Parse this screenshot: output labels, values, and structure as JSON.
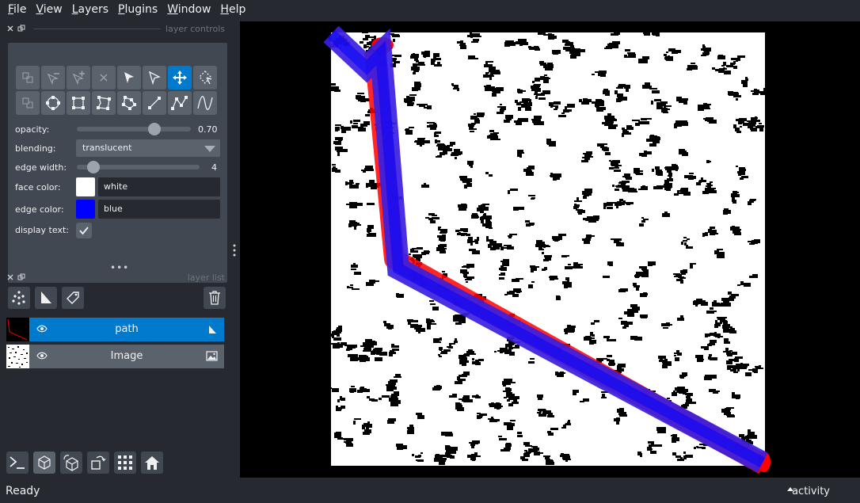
{
  "menu": {
    "items": [
      {
        "accel": "F",
        "rest": "ile"
      },
      {
        "accel": "V",
        "rest": "iew"
      },
      {
        "accel": "L",
        "rest": "ayers"
      },
      {
        "accel": "P",
        "rest": "lugins"
      },
      {
        "accel": "W",
        "rest": "indow"
      },
      {
        "accel": "H",
        "rest": "elp"
      }
    ]
  },
  "layer_controls": {
    "title": "layer controls",
    "opacity_label": "opacity:",
    "opacity_value": "0.70",
    "opacity": 0.7,
    "blending_label": "blending:",
    "blending_value": "translucent",
    "edge_width_label": "edge width:",
    "edge_width_value": "4",
    "face_color_label": "face color:",
    "face_color_value": "white",
    "face_color_hex": "#ffffff",
    "edge_color_label": "edge color:",
    "edge_color_value": "blue",
    "edge_color_hex": "#0000ff",
    "display_text_label": "display text:",
    "display_text_checked": true
  },
  "layer_list": {
    "title": "layer list",
    "layers": [
      {
        "name": "path",
        "selected": true,
        "visible": true,
        "type": "shapes"
      },
      {
        "name": "Image",
        "selected": false,
        "visible": true,
        "type": "image"
      }
    ]
  },
  "status": {
    "text": "Ready",
    "activity": "activity"
  },
  "colors": {
    "accent": "#007acc",
    "path_edge": "#0000ff",
    "path_highlight": "#ff0000"
  }
}
